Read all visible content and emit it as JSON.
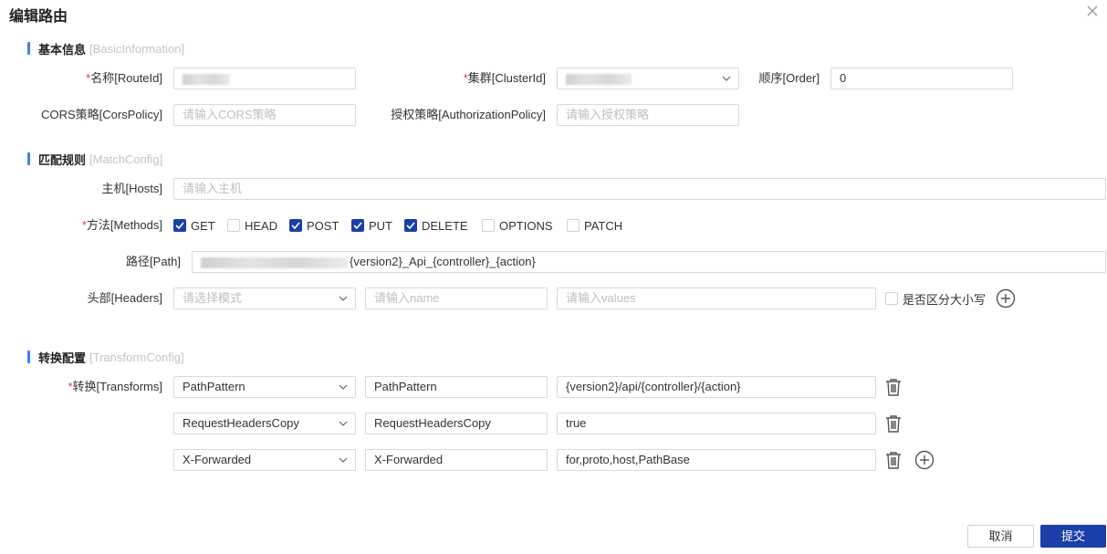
{
  "dialog": {
    "title": "编辑路由"
  },
  "sections": {
    "basic": {
      "title": "基本信息",
      "subtitle": "[BasicInformation]"
    },
    "match": {
      "title": "匹配规则",
      "subtitle": "[MatchConfig]"
    },
    "transform": {
      "title": "转换配置",
      "subtitle": "[TransformConfig]"
    }
  },
  "basic": {
    "route_id": {
      "label": "名称[RouteId]",
      "required_mark": "*"
    },
    "cluster_id": {
      "label": "集群[ClusterId]",
      "required_mark": "*"
    },
    "order": {
      "label": "顺序[Order]",
      "value": "0"
    },
    "cors": {
      "label": "CORS策略[CorsPolicy]",
      "placeholder": "请输入CORS策略"
    },
    "auth": {
      "label": "授权策略[AuthorizationPolicy]",
      "placeholder": "请输入授权策略"
    }
  },
  "match": {
    "hosts": {
      "label": "主机[Hosts]",
      "placeholder": "请输入主机"
    },
    "methods": {
      "label": "方法[Methods]",
      "required_mark": "*",
      "options": [
        {
          "label": "GET",
          "checked": true
        },
        {
          "label": "HEAD",
          "checked": false
        },
        {
          "label": "POST",
          "checked": true
        },
        {
          "label": "PUT",
          "checked": true
        },
        {
          "label": "DELETE",
          "checked": true
        },
        {
          "label": "OPTIONS",
          "checked": false
        },
        {
          "label": "PATCH",
          "checked": false
        }
      ]
    },
    "path": {
      "label": "路径[Path]",
      "value_suffix": "{version2}_Api_{controller}_{action}"
    },
    "headers": {
      "label": "头部[Headers]",
      "mode_placeholder": "请选择模式",
      "name_placeholder": "请输入name",
      "values_placeholder": "请输入values",
      "case_label": "是否区分大小写"
    }
  },
  "transform": {
    "label": "转换[Transforms]",
    "required_mark": "*",
    "rows": [
      {
        "type": "PathPattern",
        "key": "PathPattern",
        "value": "{version2}/api/{controller}/{action}"
      },
      {
        "type": "RequestHeadersCopy",
        "key": "RequestHeadersCopy",
        "value": "true"
      },
      {
        "type": "X-Forwarded",
        "key": "X-Forwarded",
        "value": "for,proto,host,PathBase"
      }
    ]
  },
  "footer": {
    "cancel_label": "取消",
    "submit_label": "提交"
  },
  "colors": {
    "accent": "#1a3fa8",
    "section_bar": "#3b82f6",
    "required": "#e53935"
  },
  "icons": {
    "close": "close-icon",
    "dropdown": "chevron-down-icon",
    "delete": "trash-icon",
    "add": "plus-circle-icon",
    "check": "check-icon"
  }
}
